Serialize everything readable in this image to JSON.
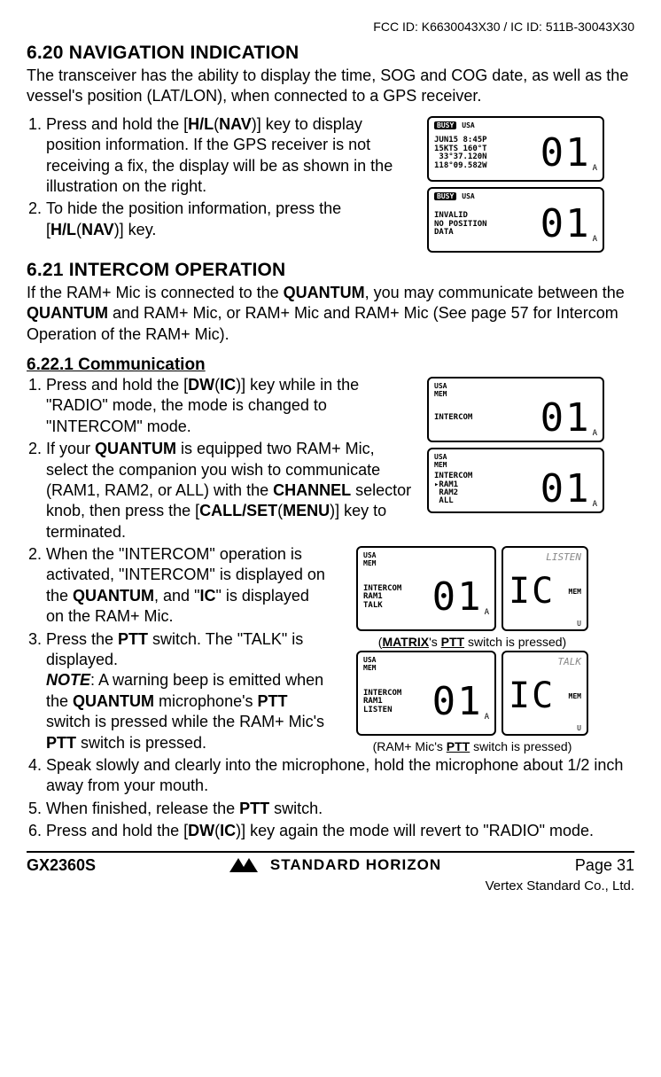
{
  "fcc": "FCC ID: K6630043X30 / IC ID: 511B-30043X30",
  "section_620": {
    "title": "6.20  NAVIGATION INDICATION",
    "lead": "The transceiver has the ability to display the time, SOG and COG date, as well as the vessel's position (LAT/LON), when connected to a GPS receiver.",
    "steps": [
      "Press and hold the [H/L(NAV)] key to display position information. If the GPS receiver is not receiving a fix, the display will be as shown in the illustration on the right.",
      "To hide the position information, press the [H/L(NAV)] key."
    ],
    "lcd1": {
      "top": "USA",
      "busy": "BUSY",
      "lines": "JUN15 8:45P\n15KTS 160°T\n 33°37.120N\n118°09.582W",
      "big": "01",
      "a": "A"
    },
    "lcd2": {
      "top": "USA",
      "busy": "BUSY",
      "lines": "INVALID\nNO POSITION\nDATA",
      "big": "01",
      "a": "A"
    }
  },
  "section_621": {
    "title": "6.21  INTERCOM OPERATION",
    "lead": "If the RAM+ Mic is connected to the QUANTUM, you may communicate between the QUANTUM and RAM+ Mic, or  RAM+ Mic and RAM+ Mic (See page 57 for Intercom Operation of the RAM+ Mic)."
  },
  "section_6221": {
    "title": "6.22.1  Communication",
    "steps_a": [
      "Press and hold the [DW(IC)] key while in the \"RADIO\" mode, the mode is changed to \"INTERCOM\" mode.",
      "If your QUANTUM is equipped two RAM+ Mic, select the companion you wish to communicate (RAM1, RAM2, or ALL) with the CHANNEL selector knob, then press the [CALL/SET(MENU)] key to terminated."
    ],
    "steps_b": [
      "When the \"INTERCOM\" operation is activated, \"INTERCOM\" is displayed on the QUANTUM, and \"IC\" is displayed on the RAM+ Mic.",
      "Press the PTT switch. The \"TALK\" is displayed.",
      "NOTE: A warning beep is emitted when the QUANTUM microphone's PTT switch is pressed while the RAM+ Mic's PTT switch is pressed."
    ],
    "steps_c": [
      "Speak slowly and clearly into the microphone, hold the microphone about 1/2 inch away from your mouth.",
      "When finished, release the PTT switch.",
      "Press and hold the [DW(IC)] key again the mode will revert to \"RADIO\" mode."
    ],
    "lcd_a1": {
      "top": "USA",
      "mem": "MEM",
      "lines": "INTERCOM",
      "big": "01",
      "a": "A"
    },
    "lcd_a2": {
      "top": "USA",
      "mem": "MEM",
      "lines": "INTERCOM\n▸RAM1\n RAM2\n ALL",
      "big": "01",
      "a": "A"
    },
    "lcd_b1_left": {
      "top": "USA",
      "mem": "MEM",
      "lines": "INTERCOM\nRAM1\nTALK",
      "big": "01",
      "a": "A"
    },
    "lcd_b1_right": {
      "top": "LISTEN",
      "big": "IC",
      "mem": "MEM",
      "u": "U"
    },
    "lcd_b2_left": {
      "top": "USA",
      "mem": "MEM",
      "lines": "INTERCOM\nRAM1\nLISTEN",
      "big": "01",
      "a": "A"
    },
    "lcd_b2_right": {
      "top": "TALK",
      "big": "IC",
      "mem": "MEM",
      "u": "U"
    },
    "cap1": "(MATRIX's PTT switch is pressed)",
    "cap2": "(RAM+ Mic's PTT switch is pressed)"
  },
  "footer": {
    "model": "GX2360S",
    "brand": "STANDARD HORIZON",
    "page": "Page 31",
    "copy": "Vertex Standard Co., Ltd."
  }
}
